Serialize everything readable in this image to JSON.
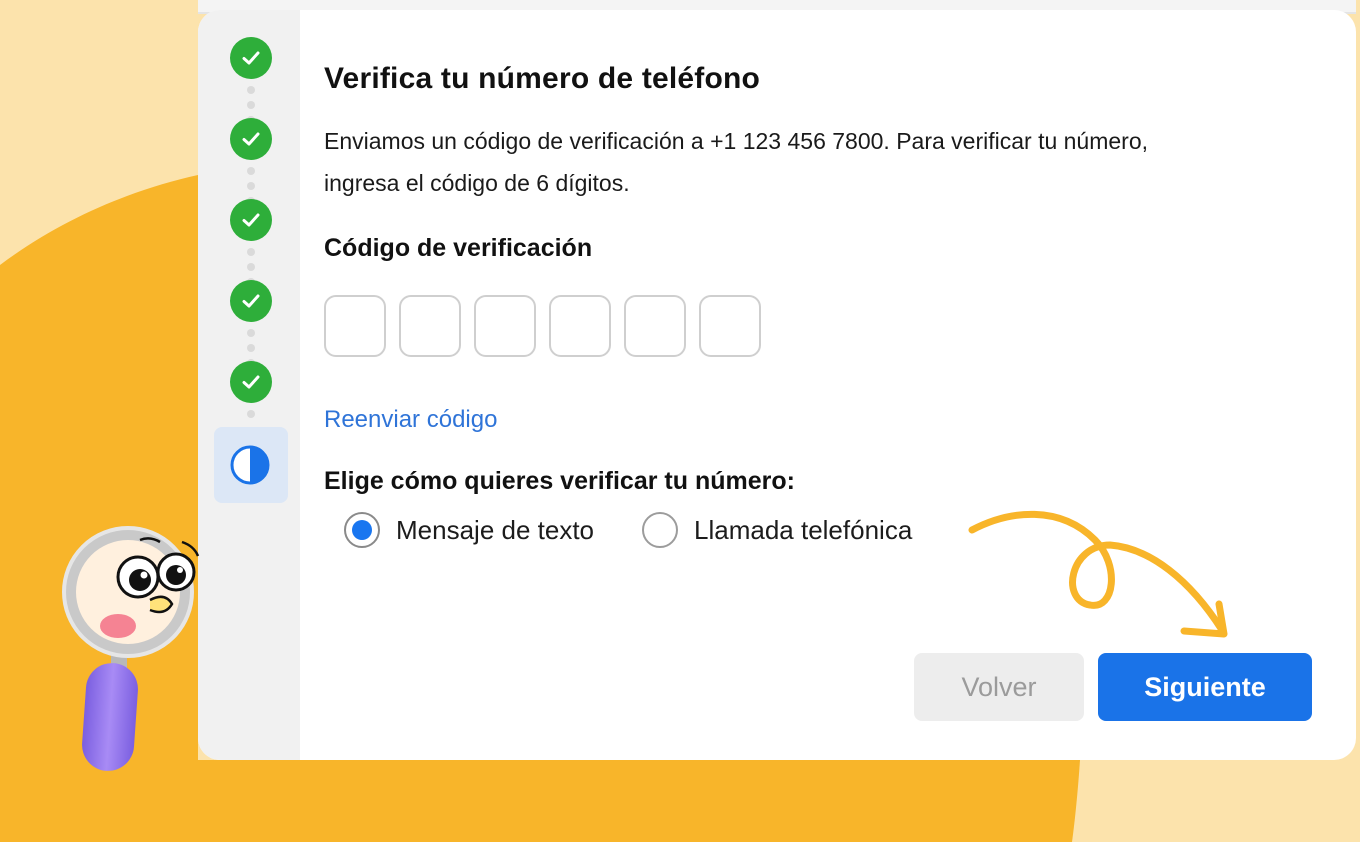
{
  "title": "Verifica tu número de teléfono",
  "description": "Enviamos un código de verificación a +1 123 456 7800. Para verificar tu número, ingresa el código de 6 dígitos.",
  "code_label": "Código de verificación",
  "code_digits": [
    "",
    "",
    "",
    "",
    "",
    ""
  ],
  "resend_label": "Reenviar código",
  "method_label": "Elige cómo quieres verificar tu número:",
  "methods": [
    {
      "label": "Mensaje de texto",
      "selected": true
    },
    {
      "label": "Llamada telefónica",
      "selected": false
    }
  ],
  "back_label": "Volver",
  "next_label": "Siguiente",
  "steps": [
    {
      "status": "complete",
      "icon": "check-icon"
    },
    {
      "status": "complete",
      "icon": "check-icon"
    },
    {
      "status": "complete",
      "icon": "check-icon"
    },
    {
      "status": "complete",
      "icon": "check-icon"
    },
    {
      "status": "complete",
      "icon": "check-icon"
    },
    {
      "status": "current",
      "icon": "half-circle-icon"
    }
  ],
  "colors": {
    "background": "#FCE3AC",
    "accent_orange": "#F8B52A",
    "primary_blue": "#1A73E8",
    "link_blue": "#2F74D8",
    "success_green": "#2EAE3A",
    "active_step_bg": "#DCE7F6"
  }
}
